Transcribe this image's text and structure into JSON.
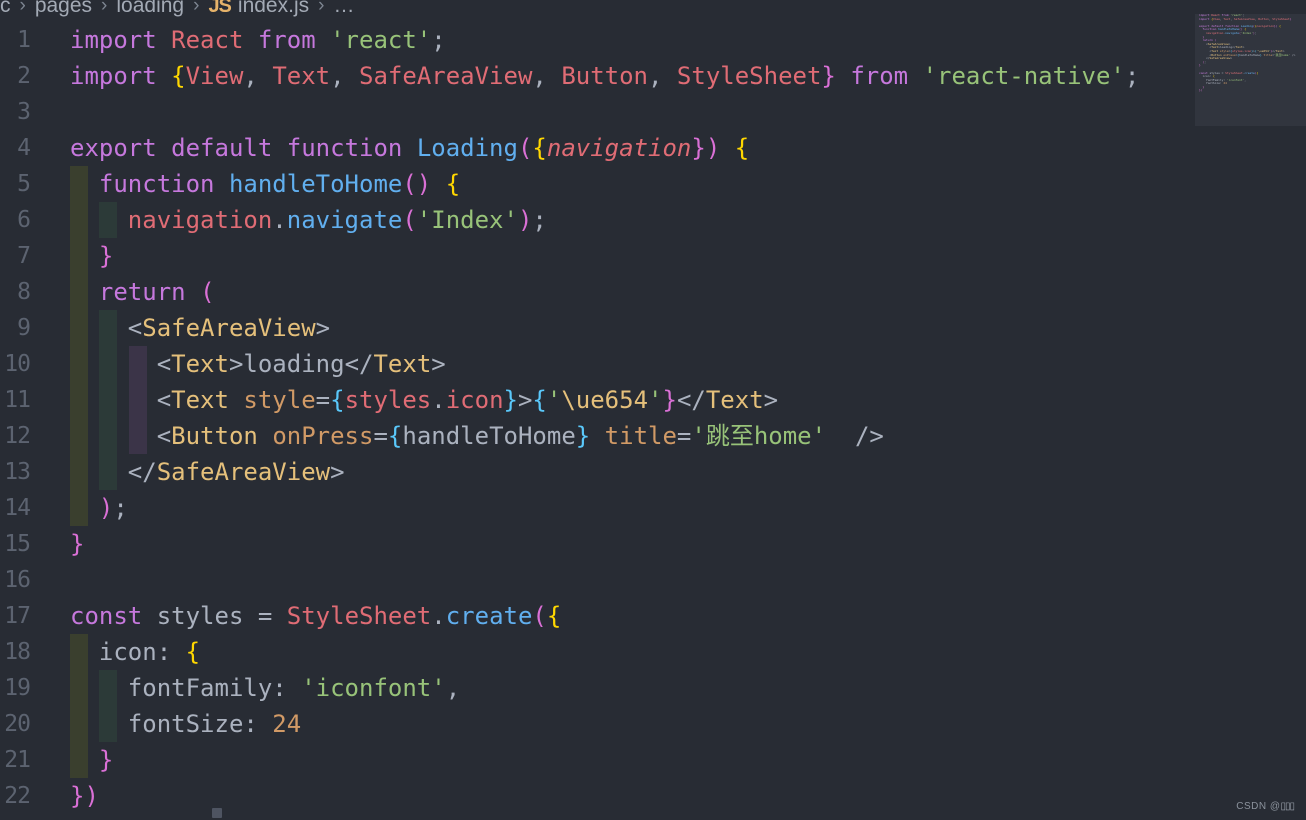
{
  "window": {
    "theme": "One Dark (VS Code)",
    "background": "#282c34"
  },
  "breadcrumb": {
    "items": [
      {
        "label": "c",
        "icon": ""
      },
      {
        "label": "pages",
        "icon": ""
      },
      {
        "label": "loading",
        "icon": ""
      },
      {
        "label": "index.js",
        "icon": "js-file-icon",
        "icon_text": "JS"
      },
      {
        "label": "…",
        "icon": ""
      }
    ],
    "separator": "›",
    "js_badge": "JS"
  },
  "editor": {
    "language": "javascript",
    "filename": "index.js",
    "first_visible_line": 1,
    "lines": [
      {
        "num": "1",
        "guides": [],
        "text": "import React from 'react';"
      },
      {
        "num": "2",
        "guides": [],
        "text": "import {View, Text, SafeAreaView, Button, StyleSheet} from 'react-native';"
      },
      {
        "num": "3",
        "guides": [],
        "text": ""
      },
      {
        "num": "4",
        "guides": [],
        "text": "export default function Loading({navigation}) {"
      },
      {
        "num": "5",
        "guides": [
          "g1"
        ],
        "text": "  function handleToHome() {"
      },
      {
        "num": "6",
        "guides": [
          "g1",
          "g2"
        ],
        "text": "    navigation.navigate('Index');"
      },
      {
        "num": "7",
        "guides": [
          "g1"
        ],
        "text": "  }"
      },
      {
        "num": "8",
        "guides": [
          "g1"
        ],
        "text": "  return ("
      },
      {
        "num": "9",
        "guides": [
          "g1",
          "g2"
        ],
        "text": "    <SafeAreaView>"
      },
      {
        "num": "10",
        "guides": [
          "g1",
          "g2",
          "g3"
        ],
        "text": "      <Text>loading</Text>"
      },
      {
        "num": "11",
        "guides": [
          "g1",
          "g2",
          "g3"
        ],
        "text": "      <Text style={styles.icon}>{'\\ue654'}</Text>"
      },
      {
        "num": "12",
        "guides": [
          "g1",
          "g2",
          "g3"
        ],
        "text": "      <Button onPress={handleToHome} title='跳至home'  />"
      },
      {
        "num": "13",
        "guides": [
          "g1",
          "g2"
        ],
        "text": "    </SafeAreaView>"
      },
      {
        "num": "14",
        "guides": [
          "g1"
        ],
        "text": "  );"
      },
      {
        "num": "15",
        "guides": [],
        "text": "}"
      },
      {
        "num": "16",
        "guides": [],
        "text": ""
      },
      {
        "num": "17",
        "guides": [],
        "text": "const styles = StyleSheet.create({"
      },
      {
        "num": "18",
        "guides": [
          "g1"
        ],
        "text": "  icon: {"
      },
      {
        "num": "19",
        "guides": [
          "g1",
          "g2"
        ],
        "text": "    fontFamily: 'iconfont',"
      },
      {
        "num": "20",
        "guides": [
          "g1",
          "g2"
        ],
        "text": "    fontSize: 24"
      },
      {
        "num": "21",
        "guides": [
          "g1"
        ],
        "text": "  }"
      },
      {
        "num": "22",
        "guides": [],
        "text": "})"
      }
    ]
  },
  "minimap": {
    "visible": true,
    "lines": [
      "import React from 'react';",
      "import {View, Text, SafeAreaView, Button, StyleSheet}",
      "",
      "export default function Loading({navigation}) {",
      "  function handleToHome() {",
      "    navigation.navigate('Index');",
      "  }",
      "  return (",
      "    <SafeAreaView>",
      "      <Text>loading</Text>",
      "      <Text style={styles.icon}>{'\\ue654'}</Text>",
      "      <Button onPress={handleToHome} title='跳至home' />",
      "    </SafeAreaView>",
      "  );",
      "}",
      "",
      "const styles = StyleSheet.create({",
      "  icon: {",
      "    fontFamily: 'iconfont',",
      "    fontSize: 24",
      "  }",
      "})"
    ]
  },
  "watermark": {
    "text": "CSDN @",
    "blocks": "▯▯▯"
  },
  "colors": {
    "background": "#282c34",
    "line_number": "#5c6370",
    "keyword": "#c678dd",
    "string": "#98c379",
    "function": "#61afef",
    "variable": "#e06c75",
    "number": "#d19a66",
    "attribute": "#d19a66",
    "jsx_tag": "#e5c07b",
    "plain": "#abb2bf",
    "bracket_yellow": "#ffd700",
    "bracket_pink": "#da70d6",
    "bracket_cyan": "#5ac8fa",
    "guide_olive": "#3a3f2e",
    "guide_teal": "#2c3a38",
    "guide_purple": "#3b3448"
  }
}
